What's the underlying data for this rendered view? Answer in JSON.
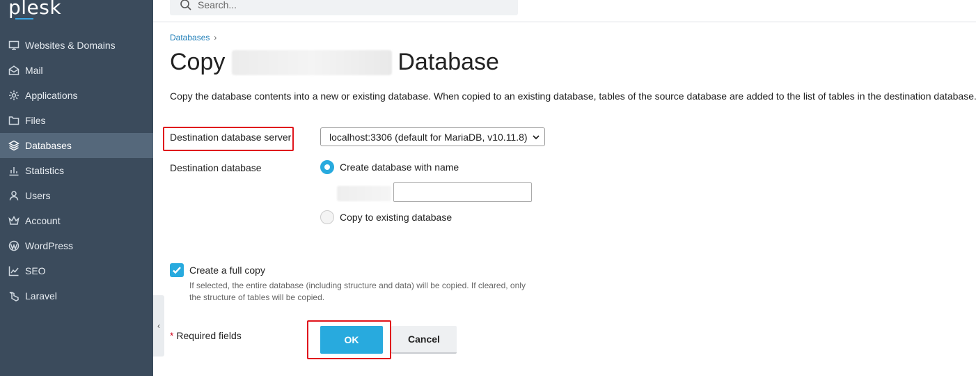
{
  "app": {
    "logo": "plesk",
    "accent": "#28aade"
  },
  "search": {
    "placeholder": "Search..."
  },
  "sidebar": {
    "items": [
      {
        "label": "Websites & Domains",
        "icon": "monitor-icon"
      },
      {
        "label": "Mail",
        "icon": "mail-icon"
      },
      {
        "label": "Applications",
        "icon": "gear-icon"
      },
      {
        "label": "Files",
        "icon": "folder-icon"
      },
      {
        "label": "Databases",
        "icon": "layers-icon",
        "active": true
      },
      {
        "label": "Statistics",
        "icon": "bar-chart-icon"
      },
      {
        "label": "Users",
        "icon": "user-icon"
      },
      {
        "label": "Account",
        "icon": "crown-icon"
      },
      {
        "label": "WordPress",
        "icon": "wordpress-icon"
      },
      {
        "label": "SEO",
        "icon": "trend-icon"
      },
      {
        "label": "Laravel",
        "icon": "laravel-icon"
      }
    ]
  },
  "breadcrumb": {
    "item": "Databases",
    "separator": "›"
  },
  "page": {
    "title_prefix": "Copy",
    "title_suffix": "Database",
    "description": "Copy the database contents into a new or existing database. When copied to an existing database, tables of the source database are added to the list of tables in the destination database. one in the destination."
  },
  "form": {
    "server_label": "Destination database server",
    "server_value": "localhost:3306 (default for MariaDB, v10.11.8)",
    "dest_label": "Destination database",
    "option_create": "Create database with name",
    "option_existing": "Copy to existing database",
    "full_copy_label": "Create a full copy",
    "full_copy_hint": "If selected, the entire database (including structure and data) will be copied. If cleared, only the structure of tables will be copied.",
    "required_star": "*",
    "required_text": " Required fields",
    "ok_label": "OK",
    "cancel_label": "Cancel"
  }
}
